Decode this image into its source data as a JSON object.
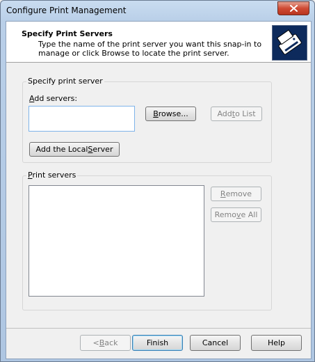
{
  "window": {
    "title": "Configure Print Management"
  },
  "header": {
    "title": "Specify Print Servers",
    "description": "Type the name of the print server you want this snap-in to manage or click Browse to locate the print server."
  },
  "specify_group": {
    "label": "Specify print server",
    "add_label": "Add servers:",
    "input_value": "",
    "browse": "Browse...",
    "add_to_list": "Add to List",
    "add_local": "Add the Local Server"
  },
  "servers_group": {
    "label": "Print servers",
    "items": [],
    "remove": "Remove",
    "remove_all": "Remove All"
  },
  "footer": {
    "back": "< Back",
    "finish": "Finish",
    "cancel": "Cancel",
    "help": "Help"
  }
}
